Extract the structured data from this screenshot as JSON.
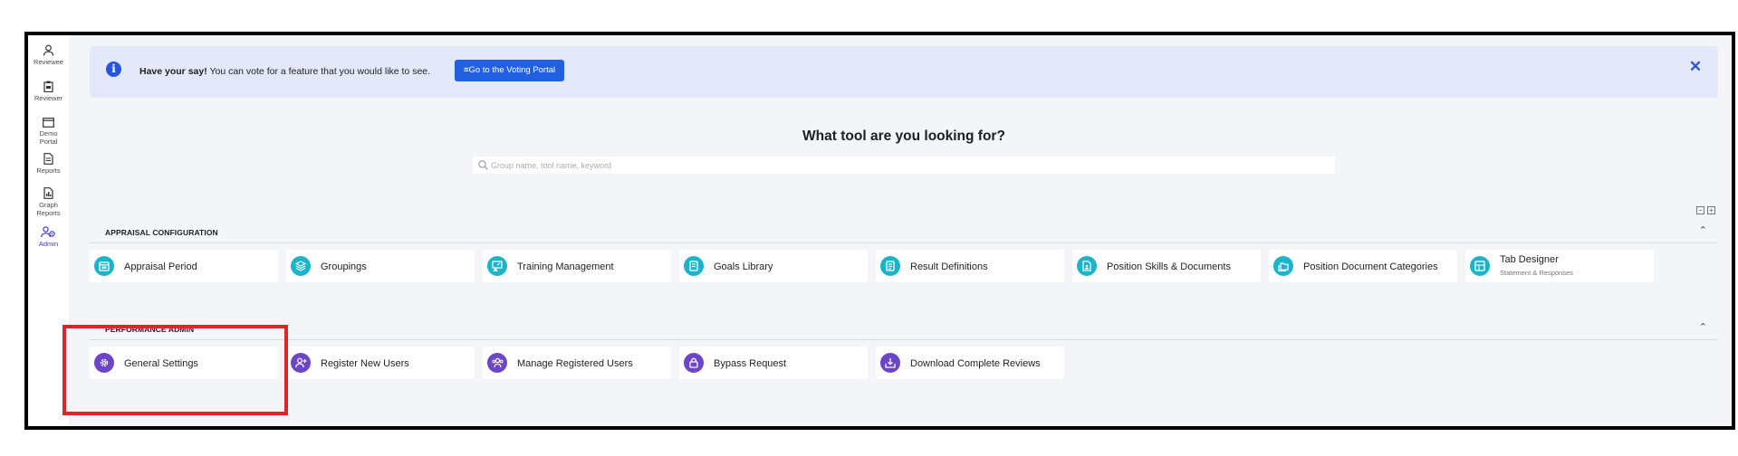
{
  "sidebar": {
    "items": [
      {
        "label": "Reviewee",
        "icon": "user-icon"
      },
      {
        "label": "Reviewer",
        "icon": "clipboard-icon"
      },
      {
        "label": "Demo Portal",
        "label_lines": [
          "Demo",
          "Portal"
        ],
        "icon": "window-icon"
      },
      {
        "label": "Reports",
        "icon": "document-icon"
      },
      {
        "label": "Graph Reports",
        "label_lines": [
          "Graph",
          "Reports"
        ],
        "icon": "chart-file-icon"
      },
      {
        "label": "Admin",
        "icon": "admin-users-icon",
        "active": true
      }
    ]
  },
  "banner": {
    "strong": "Have your say!",
    "text": " You can vote for a feature that you would like to see.",
    "button_label": "≡Go to the Voting Portal",
    "close_icon": "close-icon"
  },
  "search": {
    "title": "What tool are you looking for?",
    "placeholder": "Group name, tool name, keyword"
  },
  "sections": [
    {
      "title": "APPRAISAL CONFIGURATION",
      "tools": [
        {
          "label": "Appraisal Period",
          "icon": "calendar-icon"
        },
        {
          "label": "Groupings",
          "icon": "layers-icon"
        },
        {
          "label": "Training Management",
          "icon": "training-icon"
        },
        {
          "label": "Goals Library",
          "icon": "book-icon"
        },
        {
          "label": "Result Definitions",
          "icon": "list-doc-icon"
        },
        {
          "label": "Position Skills & Documents",
          "icon": "file-user-icon"
        },
        {
          "label": "Position Document Categories",
          "icon": "folders-icon"
        },
        {
          "label": "Tab Designer",
          "sublabel": "Statement & Responses",
          "icon": "table-icon"
        }
      ]
    },
    {
      "title": "PERFORMANCE ADMIN",
      "tools": [
        {
          "label": "General Settings",
          "icon": "gear-icon"
        },
        {
          "label": "Register New Users",
          "icon": "user-plus-icon"
        },
        {
          "label": "Manage Registered Users",
          "icon": "users-icon"
        },
        {
          "label": "Bypass Request",
          "icon": "lock-icon"
        },
        {
          "label": "Download Complete Reviews",
          "icon": "download-icon"
        }
      ]
    }
  ],
  "colors": {
    "appraisal_icon_bg": "#1cb4c9",
    "admin_icon_bg": "#6c45c9",
    "banner_bg": "#e3e8fb",
    "button_blue": "#2160e0",
    "highlight_red": "#e0242a"
  }
}
